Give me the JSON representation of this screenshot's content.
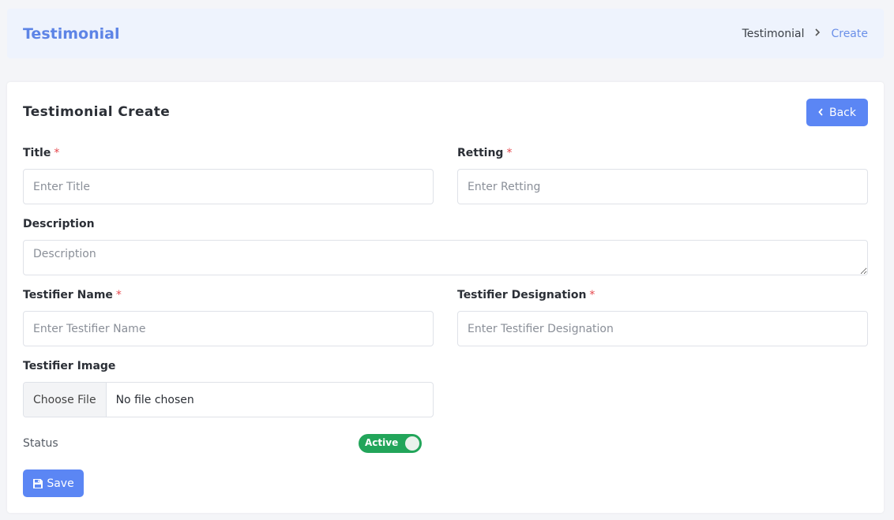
{
  "header": {
    "title": "Testimonial",
    "breadcrumb": [
      "Testimonial",
      "Create"
    ],
    "separator_icon": "chevron-right-icon"
  },
  "card": {
    "title": "Testimonial Create",
    "back_label": "Back",
    "back_icon": "chevron-left-icon"
  },
  "form": {
    "required_marker": "*",
    "title": {
      "label": "Title",
      "placeholder": "Enter Title",
      "value": ""
    },
    "retting": {
      "label": "Retting",
      "placeholder": "Enter Retting",
      "value": ""
    },
    "description": {
      "label": "Description",
      "placeholder": "Description",
      "value": ""
    },
    "testifier_name": {
      "label": "Testifier Name",
      "placeholder": "Enter Testifier Name",
      "value": ""
    },
    "testifier_designation": {
      "label": "Testifier Designation",
      "placeholder": "Enter Testifier Designation",
      "value": ""
    },
    "testifier_image": {
      "label": "Testifier Image",
      "button": "Choose File",
      "file_text": "No file chosen"
    },
    "status": {
      "label": "Status",
      "toggle_text": "Active",
      "on": true
    },
    "save_label": "Save",
    "save_icon": "floppy-disk-icon"
  },
  "colors": {
    "accent": "#5b86f4",
    "header_bg": "#eef3fd",
    "toggle_on": "#22a55a",
    "required": "#e5484d"
  }
}
